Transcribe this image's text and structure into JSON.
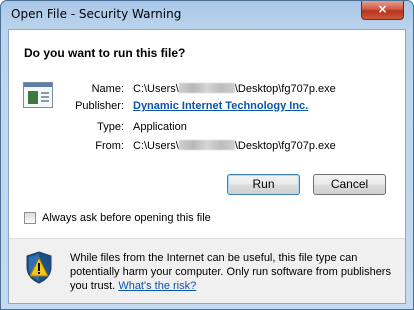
{
  "window": {
    "title": "Open File - Security Warning",
    "close_glyph": "×"
  },
  "question": "Do you want to run this file?",
  "file_icon": "executable-file-icon",
  "info": {
    "name_label": "Name:",
    "name_prefix": "C:\\Users\\",
    "name_suffix": "\\Desktop\\fg707p.exe",
    "publisher_label": "Publisher:",
    "publisher_value": "Dynamic Internet Technology Inc.",
    "type_label": "Type:",
    "type_value": "Application",
    "from_label": "From:",
    "from_prefix": "C:\\Users\\",
    "from_suffix": "\\Desktop\\fg707p.exe"
  },
  "buttons": {
    "run": "Run",
    "cancel": "Cancel"
  },
  "checkbox": {
    "label": "Always ask before opening this file",
    "checked": false
  },
  "footer": {
    "icon": "warning-shield-icon",
    "text": "While files from the Internet can be useful, this file type can potentially harm your computer. Only run software from publishers you trust.",
    "link": "What's the risk?"
  },
  "colors": {
    "link": "#0a55a8",
    "close_button": "#c0392b",
    "titlebar": "#a9c7e6"
  }
}
